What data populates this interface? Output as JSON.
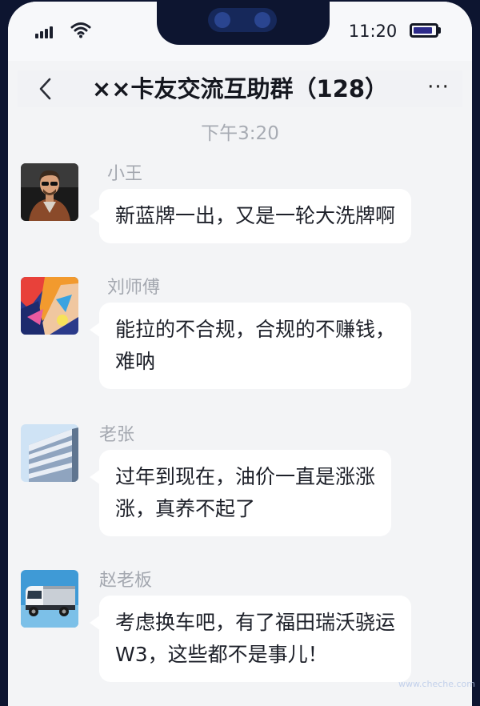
{
  "status_bar": {
    "time": "11:20",
    "signal_icon": "cellular-signal-icon",
    "wifi_icon": "wifi-icon",
    "battery_icon": "battery-icon",
    "battery_level": 0.9,
    "accent_color": "#2c2a8a"
  },
  "header": {
    "title": "××卡友交流互助群（128）",
    "back_icon": "chevron-left-icon",
    "more_label": "···"
  },
  "chat": {
    "timestamp": "下午3:20",
    "messages": [
      {
        "sender": "小王",
        "avatar_icon": "man-portrait-avatar",
        "lines": [
          "新蓝牌一出，又是一轮大洗牌啊"
        ]
      },
      {
        "sender": "刘师傅",
        "avatar_icon": "graffiti-wall-avatar",
        "lines": [
          "能拉的不合规，合规的不赚钱，",
          "难呐"
        ]
      },
      {
        "sender": "老张",
        "avatar_icon": "building-avatar",
        "lines": [
          "过年到现在，油价一直是涨涨",
          "涨，真养不起了"
        ]
      },
      {
        "sender": "赵老板",
        "avatar_icon": "truck-avatar",
        "lines": [
          "考虑换车吧，有了福田瑞沃骁运",
          "W3，这些都不是事儿！"
        ]
      }
    ]
  },
  "watermark": "www.cheche.com"
}
